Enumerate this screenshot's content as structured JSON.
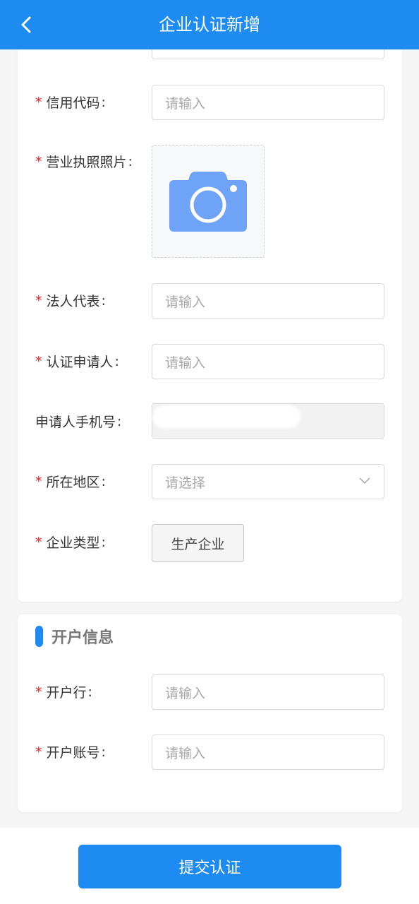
{
  "header": {
    "title": "企业认证新增"
  },
  "form": {
    "credit_code": {
      "label": "信用代码",
      "placeholder": "请输入"
    },
    "license_photo": {
      "label": "营业执照照片"
    },
    "legal_rep": {
      "label": "法人代表",
      "placeholder": "请输入"
    },
    "applicant": {
      "label": "认证申请人",
      "placeholder": "请输入"
    },
    "phone": {
      "label": "申请人手机号"
    },
    "region": {
      "label": "所在地区",
      "placeholder": "请选择"
    },
    "company_type": {
      "label": "企业类型",
      "value": "生产企业"
    }
  },
  "account": {
    "section_title": "开户信息",
    "bank": {
      "label": "开户行",
      "placeholder": "请输入"
    },
    "number": {
      "label": "开户账号",
      "placeholder": "请输入"
    }
  },
  "common": {
    "required_mark": "*",
    "colon": ":"
  },
  "submit_label": "提交认证",
  "colors": {
    "primary": "#1d8bf2",
    "required": "#e02020",
    "camera": "#6fa3f7"
  }
}
